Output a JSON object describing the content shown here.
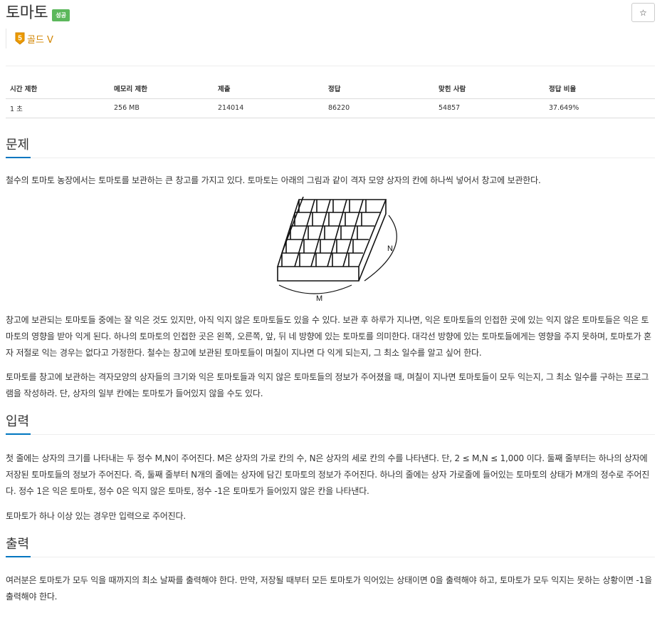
{
  "problem": {
    "title": "토마토",
    "result_badge": "성공",
    "star_label": "☆",
    "tier_number": "5",
    "tier_label": "골드 V",
    "tier_color": "#d28500",
    "accent_color": "#0076c0"
  },
  "stats": {
    "headers": [
      "시간 제한",
      "메모리 제한",
      "제출",
      "정답",
      "맞힌 사람",
      "정답 비율"
    ],
    "values": [
      "1 초",
      "256 MB",
      "214014",
      "86220",
      "54857",
      "37.649%"
    ]
  },
  "sections": {
    "problem_title": "문제",
    "problem_p1": "철수의 토마토 농장에서는 토마토를 보관하는 큰 창고를 가지고 있다. 토마토는 아래의 그림과 같이 격자 모양 상자의 칸에 하나씩 넣어서 창고에 보관한다.",
    "figure_label_m": "M",
    "figure_label_n": "N",
    "problem_p2": "창고에 보관되는 토마토들 중에는 잘 익은 것도 있지만, 아직 익지 않은 토마토들도 있을 수 있다. 보관 후 하루가 지나면, 익은 토마토들의 인접한 곳에 있는 익지 않은 토마토들은 익은 토마토의 영향을 받아 익게 된다. 하나의 토마토의 인접한 곳은 왼쪽, 오른쪽, 앞, 뒤 네 방향에 있는 토마토를 의미한다. 대각선 방향에 있는 토마토들에게는 영향을 주지 못하며, 토마토가 혼자 저절로 익는 경우는 없다고 가정한다. 철수는 창고에 보관된 토마토들이 며칠이 지나면 다 익게 되는지, 그 최소 일수를 알고 싶어 한다.",
    "problem_p3": "토마토를 창고에 보관하는 격자모양의 상자들의 크기와 익은 토마토들과 익지 않은 토마토들의 정보가 주어졌을 때, 며칠이 지나면 토마토들이 모두 익는지, 그 최소 일수를 구하는 프로그램을 작성하라. 단, 상자의 일부 칸에는 토마토가 들어있지 않을 수도 있다.",
    "input_title": "입력",
    "input_p1": "첫 줄에는 상자의 크기를 나타내는 두 정수 M,N이 주어진다. M은 상자의 가로 칸의 수, N은 상자의 세로 칸의 수를 나타낸다. 단, 2 ≤ M,N ≤ 1,000 이다. 둘째 줄부터는 하나의 상자에 저장된 토마토들의 정보가 주어진다. 즉, 둘째 줄부터 N개의 줄에는 상자에 담긴 토마토의 정보가 주어진다. 하나의 줄에는 상자 가로줄에 들어있는 토마토의 상태가 M개의 정수로 주어진다. 정수 1은 익은 토마토, 정수 0은 익지 않은 토마토, 정수 -1은 토마토가 들어있지 않은 칸을 나타낸다.",
    "input_p2": "토마토가 하나 이상 있는 경우만 입력으로 주어진다.",
    "output_title": "출력",
    "output_p1": "여러분은 토마토가 모두 익을 때까지의 최소 날짜를 출력해야 한다. 만약, 저장될 때부터 모든 토마토가 익어있는 상태이면 0을 출력해야 하고, 토마토가 모두 익지는 못하는 상황이면 -1을 출력해야 한다."
  }
}
